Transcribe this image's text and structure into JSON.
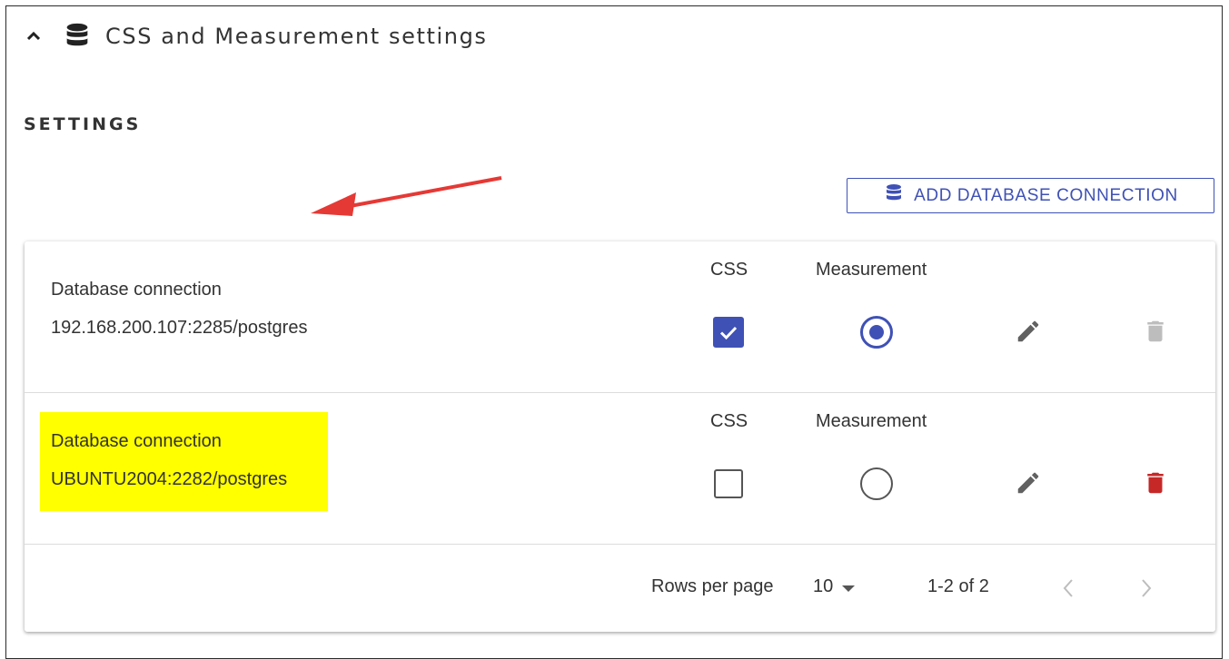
{
  "panel": {
    "title": "CSS and Measurement settings",
    "collapse_icon": "chevron-up-icon",
    "icon": "database-icon"
  },
  "section": {
    "title": "SETTINGS"
  },
  "add_button": {
    "label": "ADD DATABASE CONNECTION",
    "icon": "database-icon"
  },
  "columns": {
    "css": "CSS",
    "measurement": "Measurement"
  },
  "rows": [
    {
      "label": "Database connection",
      "value": "192.168.200.107:2285/postgres",
      "css_checked": true,
      "measurement_selected": true,
      "delete_enabled": false
    },
    {
      "label": "Database connection",
      "value": "UBUNTU2004:2282/postgres",
      "css_checked": false,
      "measurement_selected": false,
      "delete_enabled": true
    }
  ],
  "pagination": {
    "rows_per_page_label": "Rows per page",
    "rows_per_page": "10",
    "range": "1-2 of 2"
  },
  "colors": {
    "accent": "#3f51b5",
    "delete": "#c62828",
    "disabled": "#bdbdbd",
    "highlight": "#ffff00",
    "annotation_arrow": "#e53935"
  }
}
